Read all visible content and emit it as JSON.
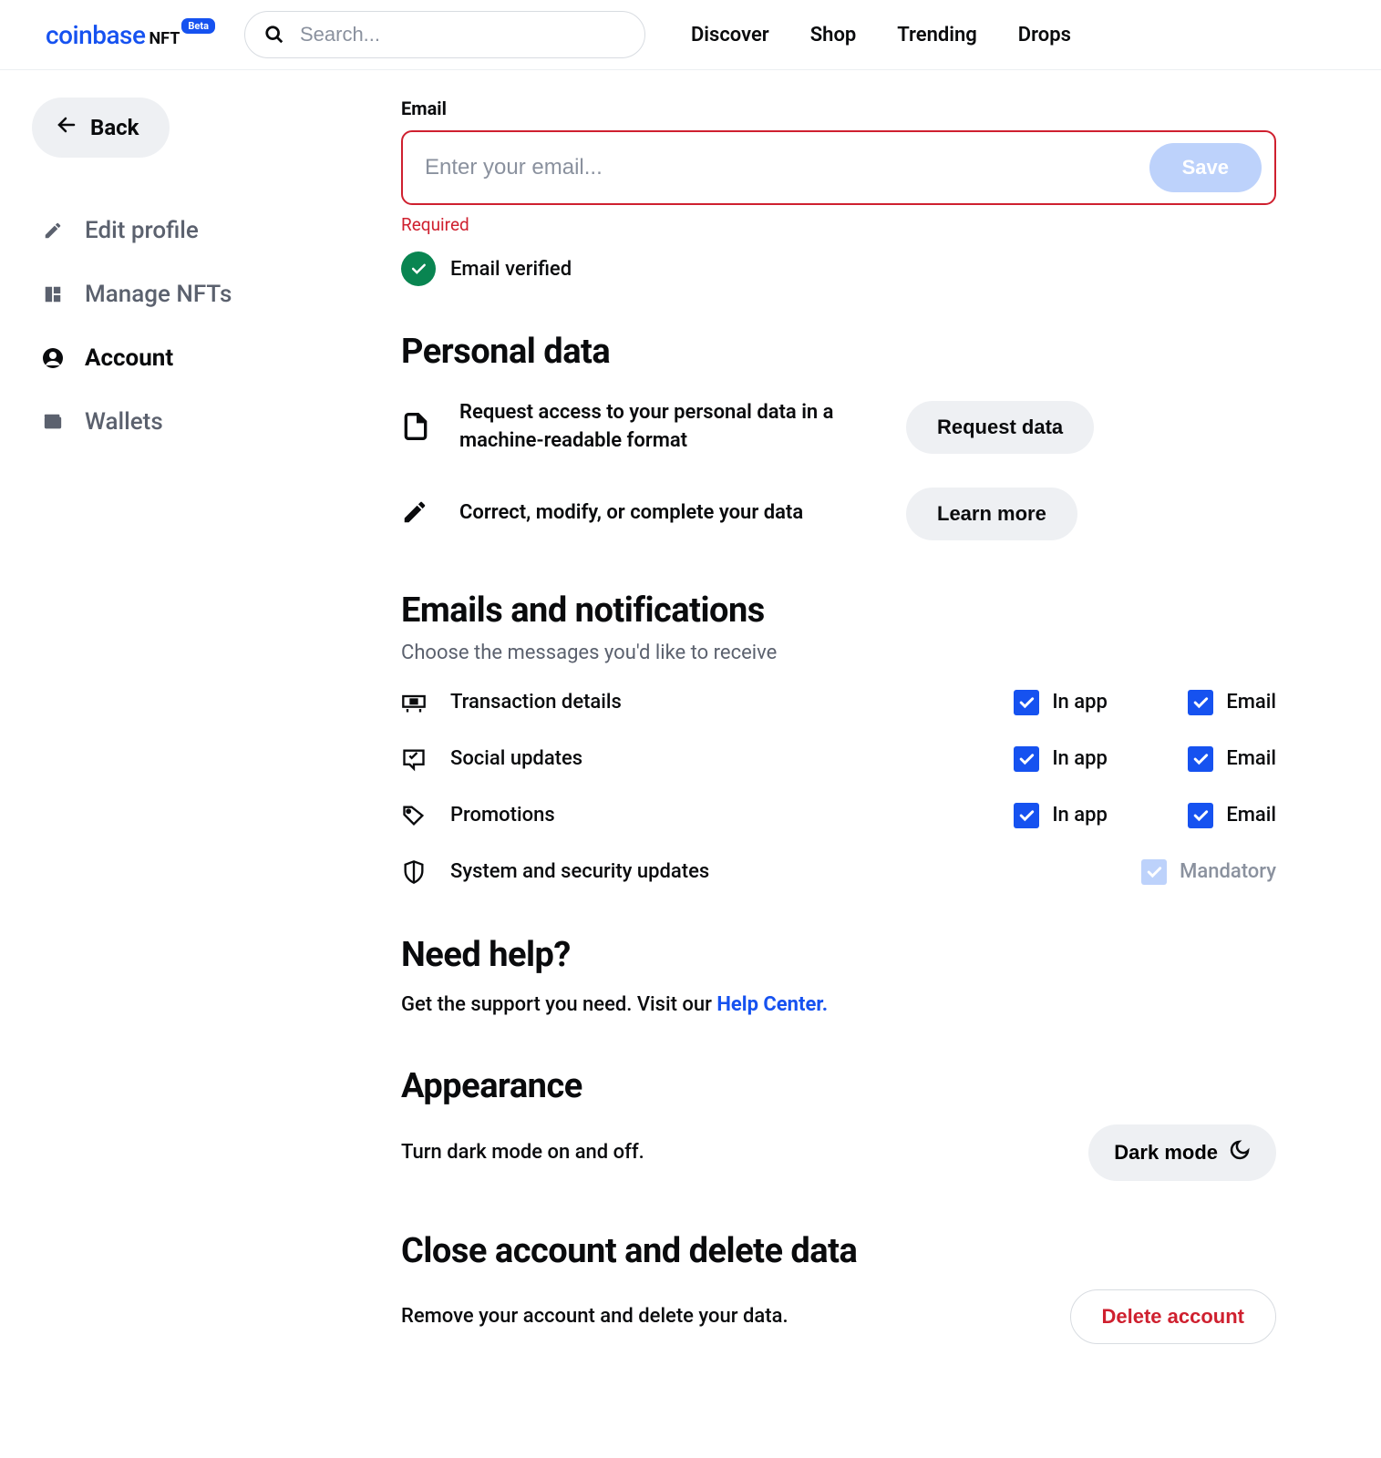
{
  "header": {
    "logo_main": "coinbase",
    "logo_sub": "NFT",
    "beta": "Beta",
    "search_placeholder": "Search...",
    "nav": [
      "Discover",
      "Shop",
      "Trending",
      "Drops"
    ]
  },
  "sidebar": {
    "back": "Back",
    "items": [
      {
        "label": "Edit profile"
      },
      {
        "label": "Manage NFTs"
      },
      {
        "label": "Account"
      },
      {
        "label": "Wallets"
      }
    ]
  },
  "email": {
    "label": "Email",
    "placeholder": "Enter your email...",
    "save": "Save",
    "error": "Required",
    "verified": "Email verified"
  },
  "personal": {
    "title": "Personal data",
    "rows": [
      {
        "text": "Request access to your personal data in a machine-readable format",
        "btn": "Request data"
      },
      {
        "text": "Correct, modify, or complete your data",
        "btn": "Learn more"
      }
    ]
  },
  "notifications": {
    "title": "Emails and notifications",
    "subtitle": "Choose the messages you'd like to receive",
    "col_inapp": "In app",
    "col_email": "Email",
    "mandatory": "Mandatory",
    "rows": [
      {
        "label": "Transaction details"
      },
      {
        "label": "Social updates"
      },
      {
        "label": "Promotions"
      },
      {
        "label": "System and security updates"
      }
    ]
  },
  "help": {
    "title": "Need help?",
    "text": "Get the support you need. Visit our ",
    "link": "Help Center."
  },
  "appearance": {
    "title": "Appearance",
    "text": "Turn dark mode on and off.",
    "btn": "Dark mode"
  },
  "close": {
    "title": "Close account and delete data",
    "text": "Remove your account and delete your data.",
    "btn": "Delete account"
  }
}
